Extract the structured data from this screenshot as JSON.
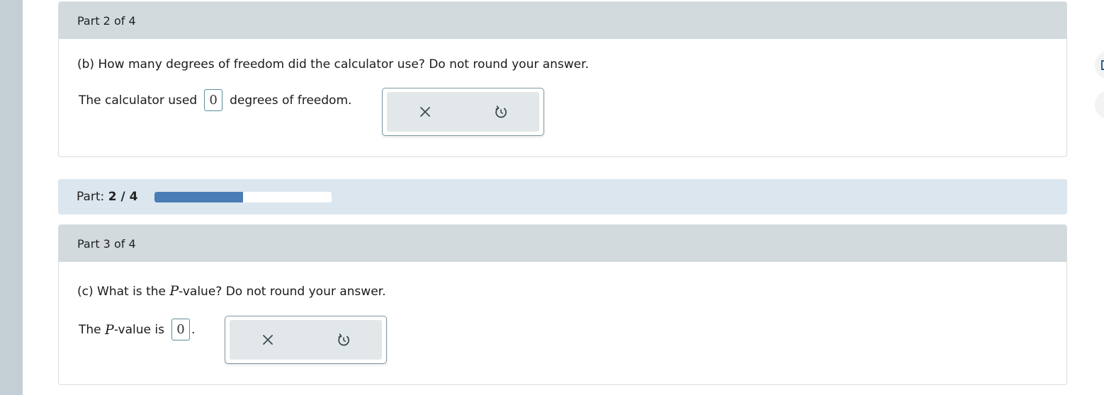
{
  "part2": {
    "header": "Part 2 of 4",
    "question": "(b) How many degrees of freedom did the calculator use? Do not round your answer.",
    "answer_prefix": "The calculator used",
    "answer_value": "0",
    "answer_suffix": "degrees of freedom."
  },
  "progress": {
    "label": "Part:",
    "value_text": "2 / 4",
    "fraction": 0.5
  },
  "part3": {
    "header": "Part 3 of 4",
    "question_prefix": "(c) What is the",
    "question_var": "P",
    "question_suffix": "-value? Do not round your answer.",
    "answer_prefix": "The",
    "answer_var": "P",
    "answer_middle": "-value is",
    "answer_value": "0",
    "answer_suffix": "."
  },
  "tools": {
    "clear_icon": "close-icon",
    "undo_icon": "undo-icon"
  },
  "colors": {
    "header_bg": "#d2dadd",
    "progress_fill": "#4a7db5",
    "progress_strip_bg": "#dce6ee",
    "answer_border": "#5e8c9c"
  }
}
